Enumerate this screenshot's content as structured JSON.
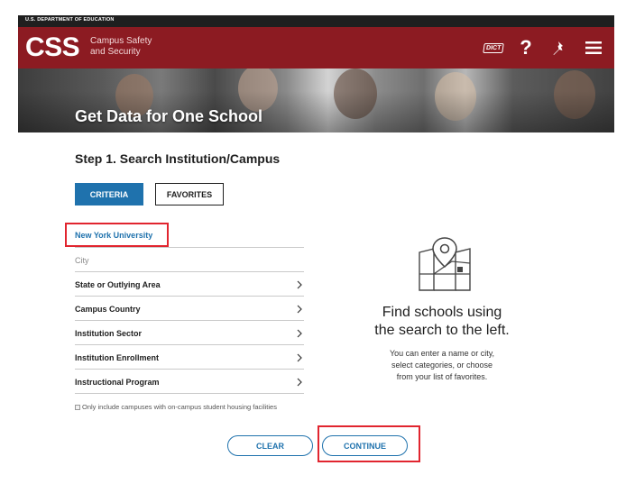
{
  "gov_bar": {
    "text": "U.S. DEPARTMENT OF EDUCATION"
  },
  "header": {
    "logo": "CSS",
    "subtitle_line1": "Campus Safety",
    "subtitle_line2": "and Security",
    "dict_label": "DICT",
    "help_label": "?",
    "brand_color": "#8c1b22",
    "icons": [
      "dictionary-icon",
      "help-icon",
      "pin-icon",
      "menu-icon"
    ]
  },
  "hero": {
    "title": "Get Data for One School"
  },
  "step": {
    "title": "Step 1. Search Institution/Campus"
  },
  "tabs": [
    {
      "label": "CRITERIA",
      "active": true
    },
    {
      "label": "FAVORITES",
      "active": false
    }
  ],
  "search": {
    "value": "New York University"
  },
  "city": {
    "placeholder": "City"
  },
  "filters": [
    {
      "label": "State or Outlying Area"
    },
    {
      "label": "Campus Country"
    },
    {
      "label": "Institution Sector"
    },
    {
      "label": "Institution Enrollment"
    },
    {
      "label": "Instructional Program"
    }
  ],
  "housing_checkbox": {
    "label": "Only include campuses with on-campus student housing facilities",
    "checked": false
  },
  "buttons": {
    "clear": "CLEAR",
    "continue": "CONTINUE"
  },
  "empty_state": {
    "title_line1": "Find schools using",
    "title_line2": "the search to the left.",
    "text_line1": "You can enter a name or city,",
    "text_line2": "select categories, or choose",
    "text_line3": "from your list of favorites."
  },
  "colors": {
    "accent": "#1f72ad",
    "highlight": "#e1252f"
  }
}
